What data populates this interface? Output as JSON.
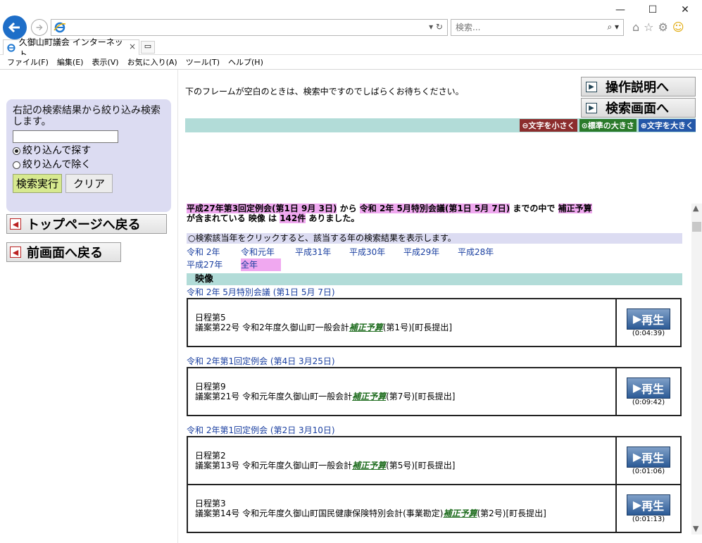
{
  "browser": {
    "search_placeholder": "検索...",
    "tab_title": "久御山町議会 インターネット...",
    "tab_close": "×",
    "addr_ctrl": "▾ ↻",
    "search_btn": "⌕ ▾",
    "menus": [
      "ファイル(F)",
      "編集(E)",
      "表示(V)",
      "お気に入り(A)",
      "ツール(T)",
      "ヘルプ(H)"
    ],
    "win_min": "—",
    "win_max": "☐",
    "win_close": "✕"
  },
  "left": {
    "filter_desc": "右記の検索結果から絞り込み検索します。",
    "radio_narrow": "絞り込んで探す",
    "radio_exclude": "絞り込んで除く",
    "exec_button": "検索実行",
    "clear_button": "クリア",
    "top_page": "トップページへ戻る",
    "prev_page": "前画面へ戻る"
  },
  "right": {
    "wait_message": "下のフレームが空白のときは、検索中ですのでしばらくお待ちください。",
    "guide_button": "操作説明へ",
    "search_screen_button": "検索画面へ",
    "size_small": "⊖文字を小さく",
    "size_std": "⊙標準の大きさ",
    "size_large": "⊕文字を大きく"
  },
  "summary": {
    "from_meeting": "平成27年第3回定例会(第1日 9月 3日)",
    "from_word": " から ",
    "to_meeting": "令和 2年 5月特別会議(第1日 5月 7日)",
    "range_word": " までの中で ",
    "keyword": "補正予算",
    "contains": "が含まれている 映像 は ",
    "count": "142件",
    "found": " ありました。"
  },
  "notice": "○検索該当年をクリックすると、該当する年の検索結果を表示します。",
  "years": [
    "令和 2年",
    "令和元年",
    "平成31年",
    "平成30年",
    "平成29年",
    "平成28年",
    "平成27年",
    "全年"
  ],
  "section_heading": "映像",
  "play_label": "再生",
  "meetings": [
    {
      "title": "令和 2年 5月特別会議 (第1日 5月 7日)",
      "items": [
        {
          "agenda": "日程第5",
          "pre": "議案第22号 令和2年度久御山町一般会計",
          "kw": "補正予算",
          "post": "(第1号)[町長提出]",
          "time": "(0:04:39)"
        }
      ]
    },
    {
      "title": "令和 2年第1回定例会 (第4日 3月25日)",
      "items": [
        {
          "agenda": "日程第9",
          "pre": "議案第21号 令和元年度久御山町一般会計",
          "kw": "補正予算",
          "post": "(第7号)[町長提出]",
          "time": "(0:09:42)"
        }
      ]
    },
    {
      "title": "令和 2年第1回定例会 (第2日 3月10日)",
      "items": [
        {
          "agenda": "日程第2",
          "pre": "議案第13号 令和元年度久御山町一般会計",
          "kw": "補正予算",
          "post": "(第5号)[町長提出]",
          "time": "(0:01:06)"
        },
        {
          "agenda": "日程第3",
          "pre": "議案第14号 令和元年度久御山町国民健康保険特別会計(事業勘定)",
          "kw": "補正予算",
          "post": "(第2号)[町長提出]",
          "time": "(0:01:13)"
        }
      ]
    }
  ]
}
